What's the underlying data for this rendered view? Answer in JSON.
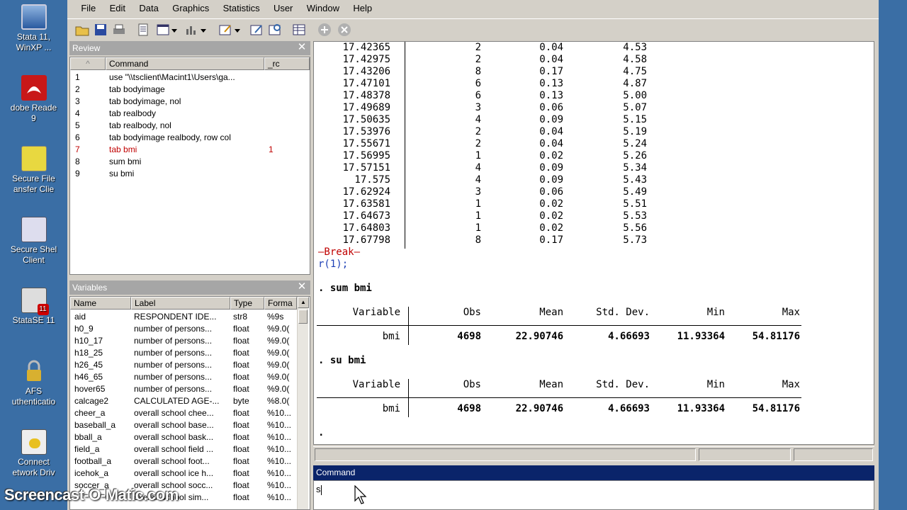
{
  "desktop": {
    "icons": [
      {
        "name": "stata-winxp-icon",
        "label": "Stata 11,\nWinXP ..."
      },
      {
        "name": "adobe-reader-icon",
        "label": "dobe Reade\n9"
      },
      {
        "name": "secure-file-transfer-icon",
        "label": "Secure File\nansfer Clie"
      },
      {
        "name": "secure-shell-client-icon",
        "label": "Secure Shel\nClient"
      },
      {
        "name": "statase-icon",
        "label": "StataSE 11"
      },
      {
        "name": "afs-auth-icon",
        "label": "AFS\nuthenticatio"
      },
      {
        "name": "connect-network-drive-icon",
        "label": "Connect\network Driv"
      }
    ]
  },
  "menu": [
    "File",
    "Edit",
    "Data",
    "Graphics",
    "Statistics",
    "User",
    "Window",
    "Help"
  ],
  "review": {
    "title": "Review",
    "col_num": "^",
    "col_command": "Command",
    "col_rc": "_rc",
    "rows": [
      {
        "n": "1",
        "cmd": "use \"\\\\tsclient\\Macint1\\Users\\ga...",
        "rc": ""
      },
      {
        "n": "2",
        "cmd": "tab bodyimage",
        "rc": ""
      },
      {
        "n": "3",
        "cmd": "tab bodyimage, nol",
        "rc": ""
      },
      {
        "n": "4",
        "cmd": "tab realbody",
        "rc": ""
      },
      {
        "n": "5",
        "cmd": "tab realbody, nol",
        "rc": ""
      },
      {
        "n": "6",
        "cmd": "tab bodyimage realbody, row col",
        "rc": ""
      },
      {
        "n": "7",
        "cmd": "tab bmi",
        "rc": "1"
      },
      {
        "n": "8",
        "cmd": "sum bmi",
        "rc": ""
      },
      {
        "n": "9",
        "cmd": "su bmi",
        "rc": ""
      }
    ]
  },
  "variables": {
    "title": "Variables",
    "col_name": "Name",
    "col_label": "Label",
    "col_type": "Type",
    "col_format": "Forma",
    "rows": [
      {
        "name": "aid",
        "label": "RESPONDENT IDE...",
        "type": "str8",
        "format": "%9s"
      },
      {
        "name": "h0_9",
        "label": "number of persons...",
        "type": "float",
        "format": "%9.0("
      },
      {
        "name": "h10_17",
        "label": "number of persons...",
        "type": "float",
        "format": "%9.0("
      },
      {
        "name": "h18_25",
        "label": "number of persons...",
        "type": "float",
        "format": "%9.0("
      },
      {
        "name": "h26_45",
        "label": "number of persons...",
        "type": "float",
        "format": "%9.0("
      },
      {
        "name": "h46_65",
        "label": "number of persons...",
        "type": "float",
        "format": "%9.0("
      },
      {
        "name": "hover65",
        "label": "number of persons...",
        "type": "float",
        "format": "%9.0("
      },
      {
        "name": "calcage2",
        "label": "CALCULATED AGE-...",
        "type": "byte",
        "format": "%8.0("
      },
      {
        "name": "cheer_a",
        "label": "overall school chee...",
        "type": "float",
        "format": "%10..."
      },
      {
        "name": "baseball_a",
        "label": "overall school base...",
        "type": "float",
        "format": "%10..."
      },
      {
        "name": "bball_a",
        "label": "overall school bask...",
        "type": "float",
        "format": "%10..."
      },
      {
        "name": "field_a",
        "label": "overall school field ...",
        "type": "float",
        "format": "%10..."
      },
      {
        "name": "football_a",
        "label": "overall school foot...",
        "type": "float",
        "format": "%10..."
      },
      {
        "name": "icehok_a",
        "label": "overall school ice h...",
        "type": "float",
        "format": "%10..."
      },
      {
        "name": "soccer_a",
        "label": "overall school socc...",
        "type": "float",
        "format": "%10..."
      },
      {
        "name": "",
        "label": "overall school sim...",
        "type": "float",
        "format": "%10..."
      }
    ]
  },
  "results": {
    "tab_rows": [
      {
        "bmi": "17.42365",
        "freq": "2",
        "pct": "0.04",
        "cum": "4.53"
      },
      {
        "bmi": "17.42975",
        "freq": "2",
        "pct": "0.04",
        "cum": "4.58"
      },
      {
        "bmi": "17.43206",
        "freq": "8",
        "pct": "0.17",
        "cum": "4.75"
      },
      {
        "bmi": "17.47101",
        "freq": "6",
        "pct": "0.13",
        "cum": "4.87"
      },
      {
        "bmi": "17.48378",
        "freq": "6",
        "pct": "0.13",
        "cum": "5.00"
      },
      {
        "bmi": "17.49689",
        "freq": "3",
        "pct": "0.06",
        "cum": "5.07"
      },
      {
        "bmi": "17.50635",
        "freq": "4",
        "pct": "0.09",
        "cum": "5.15"
      },
      {
        "bmi": "17.53976",
        "freq": "2",
        "pct": "0.04",
        "cum": "5.19"
      },
      {
        "bmi": "17.55671",
        "freq": "2",
        "pct": "0.04",
        "cum": "5.24"
      },
      {
        "bmi": "17.56995",
        "freq": "1",
        "pct": "0.02",
        "cum": "5.26"
      },
      {
        "bmi": "17.57151",
        "freq": "4",
        "pct": "0.09",
        "cum": "5.34"
      },
      {
        "bmi": "17.575",
        "freq": "4",
        "pct": "0.09",
        "cum": "5.43"
      },
      {
        "bmi": "17.62924",
        "freq": "3",
        "pct": "0.06",
        "cum": "5.49"
      },
      {
        "bmi": "17.63581",
        "freq": "1",
        "pct": "0.02",
        "cum": "5.51"
      },
      {
        "bmi": "17.64673",
        "freq": "1",
        "pct": "0.02",
        "cum": "5.53"
      },
      {
        "bmi": "17.64803",
        "freq": "1",
        "pct": "0.02",
        "cum": "5.56"
      },
      {
        "bmi": "17.67798",
        "freq": "8",
        "pct": "0.17",
        "cum": "5.73"
      }
    ],
    "break_text": "—Break—",
    "rc_text": "r(1);",
    "cmd1": ". sum bmi",
    "cmd2": ". su bmi",
    "prompt": ".",
    "sum_headers": {
      "variable": "Variable",
      "obs": "Obs",
      "mean": "Mean",
      "sd": "Std. Dev.",
      "min": "Min",
      "max": "Max"
    },
    "sum_row": {
      "variable": "bmi",
      "obs": "4698",
      "mean": "22.90746",
      "sd": "4.66693",
      "min": "11.93364",
      "max": "54.81176"
    }
  },
  "command": {
    "title": "Command",
    "value": "s"
  },
  "watermark": "Screencast-O-Matic.com",
  "colors": {
    "desktop": "#3a6ea5",
    "error": "#c00000",
    "active_title": "#0a246a",
    "inactive_title": "#a6a6a6"
  }
}
